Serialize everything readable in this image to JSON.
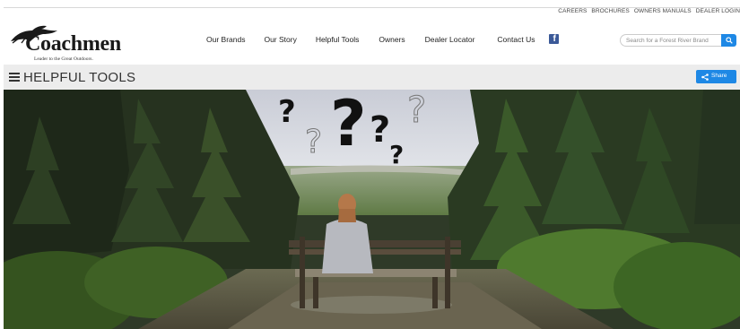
{
  "utility_nav": {
    "items": [
      "CAREERS",
      "BROCHURES",
      "OWNERS MANUALS",
      "DEALER LOGIN"
    ]
  },
  "brand": {
    "name": "Coachmen",
    "tagline": "Leader to the Great Outdoors."
  },
  "main_nav": {
    "items": [
      "Our Brands",
      "Our Story",
      "Helpful Tools",
      "Owners",
      "Dealer Locator",
      "Contact Us"
    ],
    "social_icon": "facebook-icon"
  },
  "search": {
    "placeholder": "Search for a Forest River Brand",
    "icon": "search-icon"
  },
  "page_header": {
    "title": "HELPFUL TOOLS",
    "menu_icon": "hamburger-icon",
    "share_label": "Share",
    "share_icon": "share-icon"
  },
  "hero": {
    "description_icons": [
      "question-mark-icon"
    ]
  },
  "colors": {
    "accent_blue": "#1e88e5",
    "facebook_blue": "#3b5998",
    "title_bar_bg": "#ececec"
  }
}
